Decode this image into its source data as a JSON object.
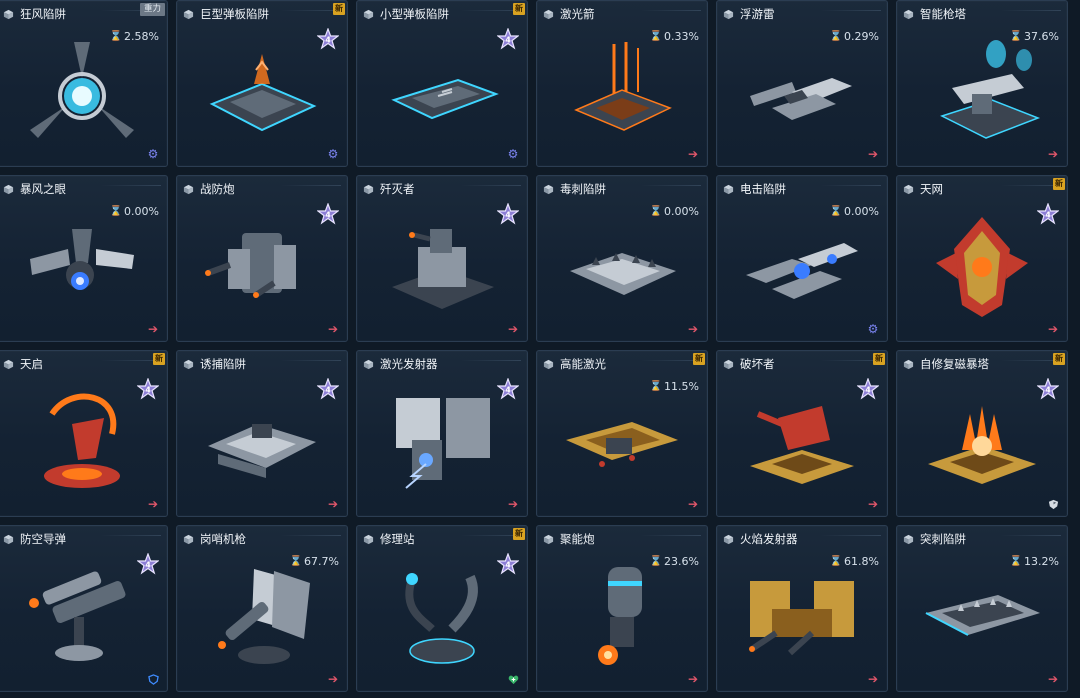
{
  "cards": [
    {
      "name": "狂风陷阱",
      "tag": "重力",
      "new": false,
      "star": false,
      "pct": "2.58%",
      "corner": "gear",
      "art": "tri"
    },
    {
      "name": "巨型弹板陷阱",
      "tag": "",
      "new": true,
      "star": true,
      "pct": "",
      "corner": "gear",
      "art": "pad"
    },
    {
      "name": "小型弹板陷阱",
      "tag": "",
      "new": true,
      "star": true,
      "pct": "",
      "corner": "gear",
      "art": "padsm"
    },
    {
      "name": "激光箭",
      "tag": "",
      "new": false,
      "star": false,
      "pct": "0.33%",
      "corner": "arrow",
      "art": "laser"
    },
    {
      "name": "浮游雷",
      "tag": "",
      "new": false,
      "star": false,
      "pct": "0.29%",
      "corner": "arrow",
      "art": "mine"
    },
    {
      "name": "智能枪塔",
      "tag": "",
      "new": false,
      "star": false,
      "pct": "37.6%",
      "corner": "arrow",
      "art": "tower"
    },
    {
      "name": "暴风之眼",
      "tag": "",
      "new": false,
      "star": false,
      "pct": "0.00%",
      "corner": "arrow",
      "art": "eye"
    },
    {
      "name": "战防炮",
      "tag": "",
      "new": false,
      "star": true,
      "pct": "",
      "corner": "arrow",
      "art": "cannon"
    },
    {
      "name": "歼灭者",
      "tag": "",
      "new": false,
      "star": true,
      "pct": "",
      "corner": "arrow",
      "art": "annih"
    },
    {
      "name": "毒刺陷阱",
      "tag": "",
      "new": false,
      "star": false,
      "pct": "0.00%",
      "corner": "arrow",
      "art": "spike"
    },
    {
      "name": "电击陷阱",
      "tag": "",
      "new": false,
      "star": false,
      "pct": "0.00%",
      "corner": "gear",
      "art": "shock"
    },
    {
      "name": "天网",
      "tag": "",
      "new": true,
      "star": true,
      "pct": "",
      "corner": "arrow",
      "art": "net"
    },
    {
      "name": "天启",
      "tag": "",
      "new": true,
      "star": true,
      "pct": "",
      "corner": "arrow",
      "art": "apoc"
    },
    {
      "name": "诱捕陷阱",
      "tag": "",
      "new": false,
      "star": true,
      "pct": "",
      "corner": "arrow",
      "art": "lure"
    },
    {
      "name": "激光发射器",
      "tag": "",
      "new": false,
      "star": true,
      "pct": "",
      "corner": "arrow",
      "art": "emitter"
    },
    {
      "name": "高能激光",
      "tag": "",
      "new": true,
      "star": false,
      "pct": "11.5%",
      "corner": "arrow",
      "art": "hilaser"
    },
    {
      "name": "破坏者",
      "tag": "",
      "new": true,
      "star": true,
      "pct": "",
      "corner": "arrow",
      "art": "breaker"
    },
    {
      "name": "自修复磁暴塔",
      "tag": "",
      "new": true,
      "star": true,
      "pct": "",
      "corner": "shield",
      "art": "tesla"
    },
    {
      "name": "防空导弹",
      "tag": "",
      "new": false,
      "star": true,
      "pct": "",
      "corner": "shieldblue",
      "art": "aa"
    },
    {
      "name": "岗哨机枪",
      "tag": "",
      "new": false,
      "star": false,
      "pct": "67.7%",
      "corner": "arrow",
      "art": "sentry"
    },
    {
      "name": "修理站",
      "tag": "",
      "new": true,
      "star": true,
      "pct": "",
      "corner": "heart",
      "art": "repair"
    },
    {
      "name": "聚能炮",
      "tag": "",
      "new": false,
      "star": false,
      "pct": "23.6%",
      "corner": "arrow",
      "art": "focus"
    },
    {
      "name": "火焰发射器",
      "tag": "",
      "new": false,
      "star": false,
      "pct": "61.8%",
      "corner": "arrow",
      "art": "flame"
    },
    {
      "name": "突刺陷阱",
      "tag": "",
      "new": false,
      "star": false,
      "pct": "13.2%",
      "corner": "arrow",
      "art": "thrust"
    }
  ],
  "badge_new_label": "新",
  "star_label": "4",
  "colors": {
    "accent_red": "#e0566a",
    "gear": "#7a83f0",
    "new": "#d9a221",
    "cyan": "#3fd6ff",
    "orange": "#ff7a1a"
  }
}
